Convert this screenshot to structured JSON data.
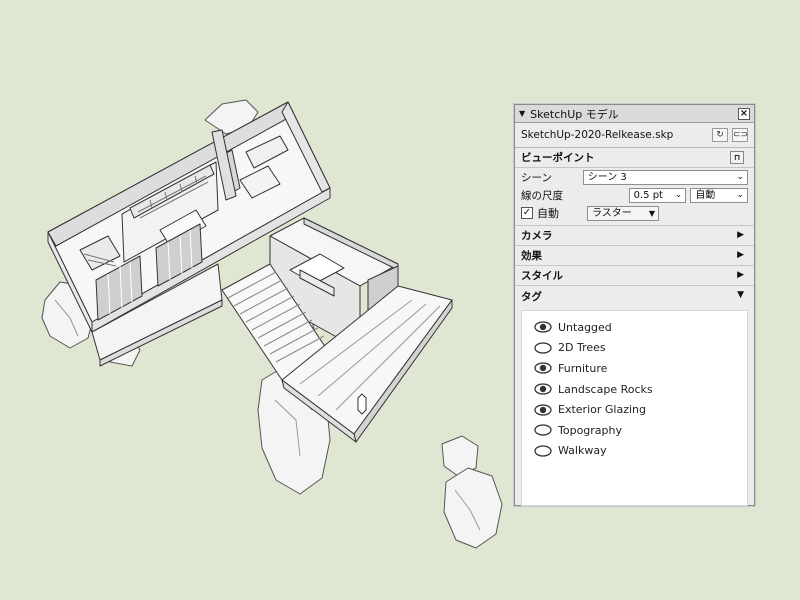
{
  "panel": {
    "title": "SketchUp モデル",
    "filename": "SketchUp-2020-Relkease.skp"
  },
  "viewpoint": {
    "heading": "ビューポイント",
    "scene_label": "シーン",
    "scene_value": "シーン 3",
    "line_scale_label": "線の尺度",
    "line_scale_value": "0.5 pt",
    "line_scale_mode": "自動",
    "auto_label": "自動",
    "render_mode": "ラスター"
  },
  "sections": {
    "camera": "カメラ",
    "effects": "効果",
    "style": "スタイル",
    "tags": "タグ"
  },
  "tags": [
    {
      "name": "Untagged",
      "visible": true
    },
    {
      "name": "2D Trees",
      "visible": false
    },
    {
      "name": "Furniture",
      "visible": true
    },
    {
      "name": "Landscape Rocks",
      "visible": true
    },
    {
      "name": "Exterior Glazing",
      "visible": true
    },
    {
      "name": "Topography",
      "visible": false
    },
    {
      "name": "Walkway",
      "visible": false
    }
  ],
  "icons": {
    "collapse": "triangle-down-icon",
    "close": "close-icon",
    "refresh": "refresh-icon",
    "link": "link-icon",
    "lock": "lock-icon",
    "expand": "triangle-right-icon",
    "visibility_on": "eye-open-icon",
    "visibility_off": "eye-closed-icon"
  },
  "colors": {
    "background": "#dfe6d2",
    "panel": "#ececec"
  }
}
